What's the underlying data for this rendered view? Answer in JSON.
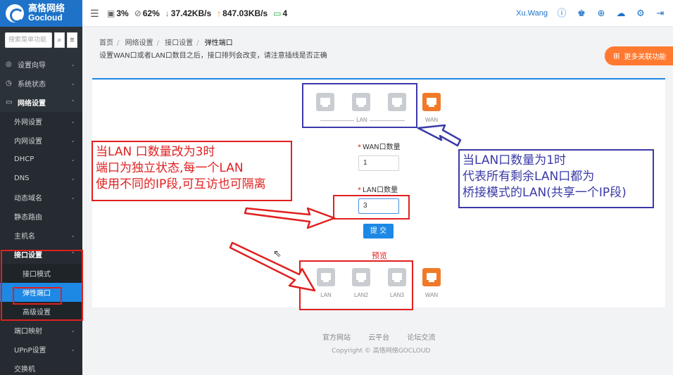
{
  "logo": {
    "cn": "高恪网络",
    "en": "Gocloud"
  },
  "stats": {
    "cpu": "3%",
    "mem": "62%",
    "down_speed": "37.42KB/s",
    "up_speed": "847.03KB/s",
    "devices": "4"
  },
  "user": "Xu.Wang",
  "sidebar": {
    "search_placeholder": "搜索菜单功能",
    "items": [
      {
        "label": "设置向导"
      },
      {
        "label": "系统状态"
      },
      {
        "label": "网络设置"
      },
      {
        "label": "外网设置"
      },
      {
        "label": "内网设置"
      },
      {
        "label": "DHCP"
      },
      {
        "label": "DNS"
      },
      {
        "label": "动态域名"
      },
      {
        "label": "静态路由"
      },
      {
        "label": "主机名"
      },
      {
        "label": "接口设置"
      },
      {
        "label": "接口模式"
      },
      {
        "label": "弹性端口"
      },
      {
        "label": "高级设置"
      },
      {
        "label": "端口映射"
      },
      {
        "label": "UPnP设置"
      },
      {
        "label": "交换机"
      }
    ]
  },
  "breadcrumb": [
    "首页",
    "网络设置",
    "接口设置",
    "弹性端口"
  ],
  "note": "设置WAN口或者LAN口数目之后，接口排列会改变，请注意插线是否正确",
  "more_button": "更多关联功能",
  "top_ports": {
    "group_label": "LAN",
    "wan_label": "WAN"
  },
  "form": {
    "wan_label": "WAN口数量",
    "wan_value": "1",
    "lan_label": "LAN口数量",
    "lan_value": "3",
    "submit": "提 交"
  },
  "preview": {
    "title": "预览",
    "labels": [
      "LAN",
      "LAN2",
      "LAN3",
      "WAN"
    ]
  },
  "callouts": {
    "left": [
      "当LAN 口数量改为3时",
      "端口为独立状态,每一个LAN",
      "使用不同的IP段,可互访也可隔离"
    ],
    "right": [
      "当LAN口数量为1时",
      "代表所有剩余LAN口都为",
      "桥接模式的LAN(共享一个IP段)"
    ]
  },
  "footer": {
    "links": [
      "官方网站",
      "云平台",
      "论坛交流"
    ],
    "copyright": "Copyright © 高恪网络GOCLOUD"
  },
  "colors": {
    "brand": "#1e73c8",
    "accent": "#1e88e5",
    "wan": "#f07a2a",
    "annotation_red": "#e02020",
    "annotation_blue": "#3a3aa8"
  }
}
